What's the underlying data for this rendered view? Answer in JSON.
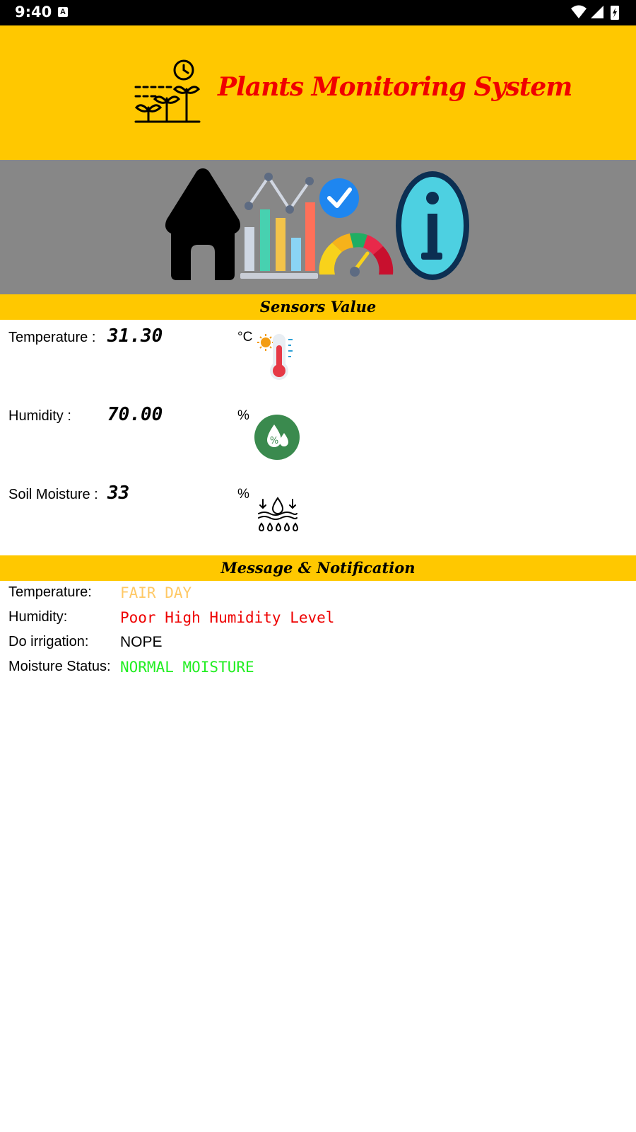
{
  "status_bar": {
    "time": "9:40",
    "notification_icon": "A"
  },
  "header": {
    "title": "Plants Monitoring System",
    "logo_icon": "plant-timer-icon"
  },
  "nav": {
    "icons": [
      "home-icon",
      "chart-icon",
      "gauge-check-icon",
      "info-icon"
    ]
  },
  "sensors": {
    "section_title": "Sensors Value",
    "temperature": {
      "label": "Temperature :",
      "value": "31.30",
      "unit": "°C",
      "icon": "thermometer-icon"
    },
    "humidity": {
      "label": "Humidity :",
      "value": "70.00",
      "unit": "%",
      "icon": "humidity-drop-icon"
    },
    "soil_moisture": {
      "label": "Soil Moisture :",
      "value": "33",
      "unit": "%",
      "icon": "soil-moisture-icon"
    }
  },
  "messages": {
    "section_title": "Message & Notification",
    "temperature": {
      "label": "Temperature:",
      "value": "FAIR DAY",
      "color": "#FFC966"
    },
    "humidity": {
      "label": "Humidity:",
      "value": "Poor High Humidity Level",
      "color": "#EE0000"
    },
    "irrigation": {
      "label": "Do irrigation:",
      "value": "NOPE",
      "color": "#000000"
    },
    "moisture": {
      "label": "Moisture Status:",
      "value": "NORMAL MOISTURE",
      "color": "#22EE22"
    }
  },
  "colors": {
    "accent": "#FFC800",
    "nav_bg": "#878787",
    "title": "#F00000"
  }
}
